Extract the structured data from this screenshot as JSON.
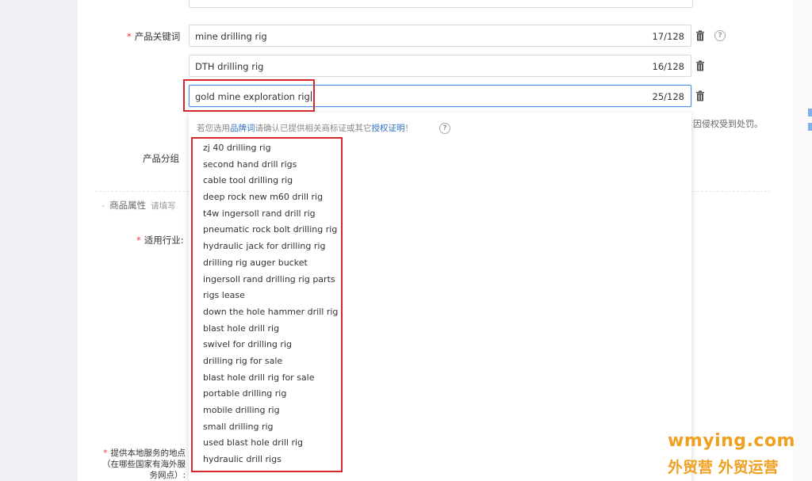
{
  "form": {
    "keyword_label": "产品关键词",
    "required_mark": "*",
    "keywords": [
      {
        "value": "mine drilling rig",
        "count": "17/128"
      },
      {
        "value": "DTH drilling rig",
        "count": "16/128"
      },
      {
        "value": "gold mine exploration rig",
        "count": "25/128"
      }
    ],
    "group_label": "产品分组",
    "attributes_title": "商品属性",
    "attributes_sub": "请填写",
    "industry_label": "适用行业:",
    "service_label_line1": "提供本地服务的地点",
    "service_label_line2": "（在哪些国家有海外服",
    "service_label_line3": "务网点）:",
    "side_note": "因侵权受到处罚。"
  },
  "dropdown": {
    "hint_prefix": "若您选用",
    "hint_link1": "品牌词",
    "hint_mid": "请确认已提供相关商标证或其它",
    "hint_link2": "授权证明",
    "hint_suffix": "！",
    "suggestions": [
      "zj 40 drilling rig",
      "second hand drill rigs",
      "cable tool drilling rig",
      "deep rock new m60 drill rig",
      "t4w ingersoll rand drill rig",
      "pneumatic rock bolt drilling rig",
      "hydraulic jack for drilling rig",
      "drilling rig auger bucket",
      "ingersoll rand drilling rig parts",
      "rigs lease",
      "down the hole hammer drill rig",
      "blast hole drill rig",
      "swivel for drilling rig",
      "drilling rig for sale",
      "blast hole drill rig for sale",
      "portable drilling rig",
      "mobile drilling rig",
      "small drilling rig",
      "used blast hole drill rig",
      "hydraulic drill rigs"
    ]
  },
  "watermark": {
    "domain": "wmying.com",
    "tagline": "外贸营 外贸运营"
  },
  "colors": {
    "highlight_red": "#d8282f",
    "link_blue": "#2f6ec2",
    "watermark_orange": "#f0a020"
  },
  "icons": {
    "trash": "trash-icon",
    "help": "help-icon"
  }
}
